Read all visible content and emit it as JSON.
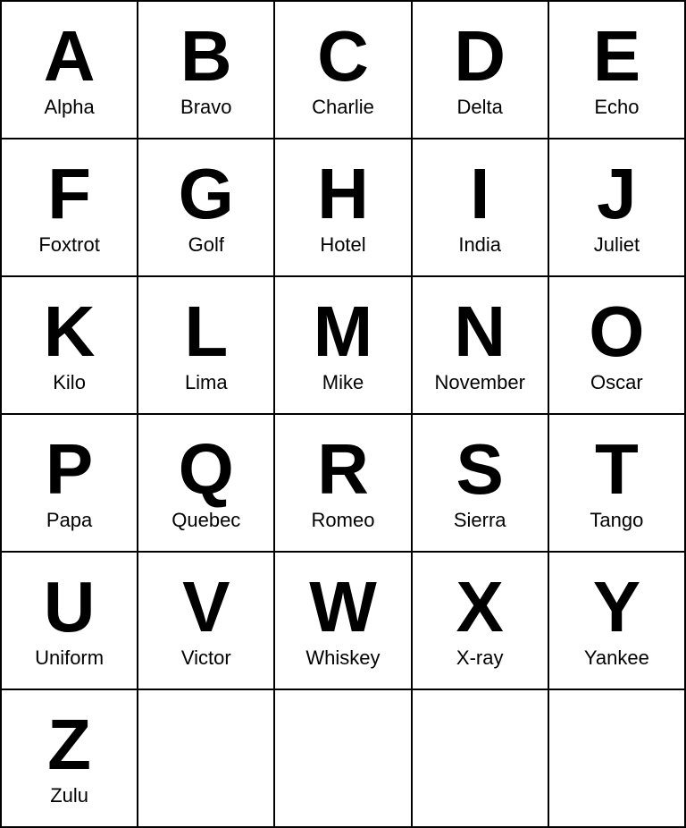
{
  "alphabet": [
    {
      "letter": "A",
      "word": "Alpha"
    },
    {
      "letter": "B",
      "word": "Bravo"
    },
    {
      "letter": "C",
      "word": "Charlie"
    },
    {
      "letter": "D",
      "word": "Delta"
    },
    {
      "letter": "E",
      "word": "Echo"
    },
    {
      "letter": "F",
      "word": "Foxtrot"
    },
    {
      "letter": "G",
      "word": "Golf"
    },
    {
      "letter": "H",
      "word": "Hotel"
    },
    {
      "letter": "I",
      "word": "India"
    },
    {
      "letter": "J",
      "word": "Juliet"
    },
    {
      "letter": "K",
      "word": "Kilo"
    },
    {
      "letter": "L",
      "word": "Lima"
    },
    {
      "letter": "M",
      "word": "Mike"
    },
    {
      "letter": "N",
      "word": "November"
    },
    {
      "letter": "O",
      "word": "Oscar"
    },
    {
      "letter": "P",
      "word": "Papa"
    },
    {
      "letter": "Q",
      "word": "Quebec"
    },
    {
      "letter": "R",
      "word": "Romeo"
    },
    {
      "letter": "S",
      "word": "Sierra"
    },
    {
      "letter": "T",
      "word": "Tango"
    },
    {
      "letter": "U",
      "word": "Uniform"
    },
    {
      "letter": "V",
      "word": "Victor"
    },
    {
      "letter": "W",
      "word": "Whiskey"
    },
    {
      "letter": "X",
      "word": "X-ray"
    },
    {
      "letter": "Y",
      "word": "Yankee"
    },
    {
      "letter": "Z",
      "word": "Zulu"
    }
  ]
}
